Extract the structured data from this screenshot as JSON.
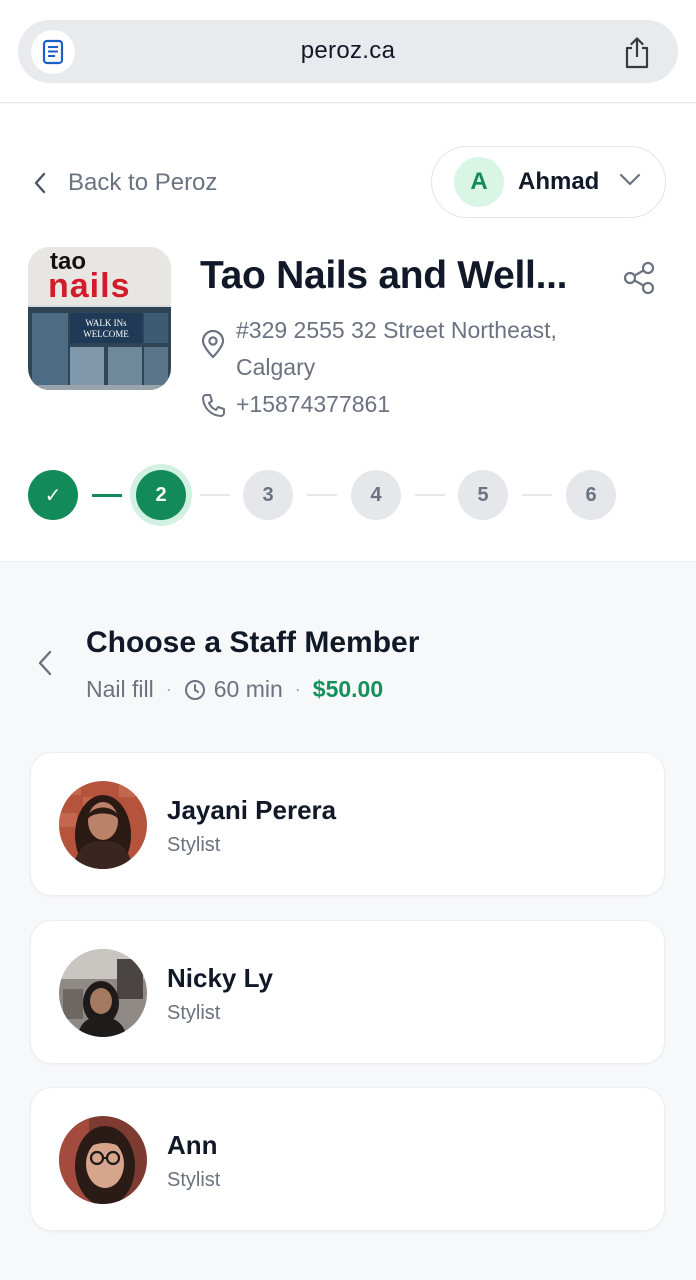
{
  "browser": {
    "url": "peroz.ca",
    "reader_icon": "reader-mode-icon",
    "share_icon": "share-upload-icon"
  },
  "header": {
    "back_label": "Back to Peroz",
    "user": {
      "initial": "A",
      "name": "Ahmad"
    },
    "shop": {
      "logo_text_top": "tao",
      "logo_text_bottom": "nails",
      "logo_sign": "WALK INs WELCOME",
      "name": "Tao Nails and Well...",
      "address": "#329 2555 32 Street Northeast, Calgary",
      "phone": "+15874377861"
    },
    "steps": [
      {
        "label": "✓",
        "state": "done"
      },
      {
        "label": "2",
        "state": "active"
      },
      {
        "label": "3",
        "state": "pending"
      },
      {
        "label": "4",
        "state": "pending"
      },
      {
        "label": "5",
        "state": "pending"
      },
      {
        "label": "6",
        "state": "pending"
      }
    ]
  },
  "main": {
    "title": "Choose a Staff Member",
    "service": "Nail fill",
    "separator": "·",
    "duration": "60 min",
    "price": "$50.00",
    "staff": [
      {
        "name": "Jayani Perera",
        "role": "Stylist"
      },
      {
        "name": "Nicky Ly",
        "role": "Stylist"
      },
      {
        "name": "Ann",
        "role": "Stylist"
      }
    ]
  },
  "colors": {
    "accent": "#138a59",
    "accent_light": "#d2f1e2",
    "price": "#15915e",
    "muted": "#6b7280"
  }
}
